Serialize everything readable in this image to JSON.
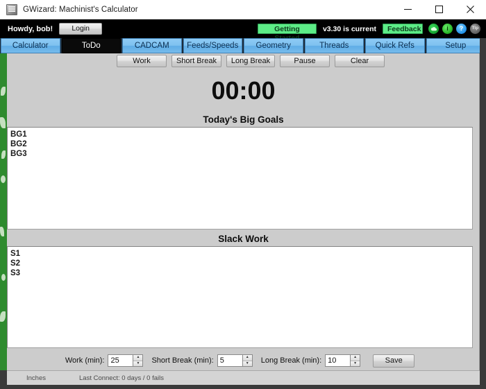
{
  "window": {
    "title": "GWizard: Machinist's Calculator",
    "app_icon": "app-window-icon",
    "minimize": "─",
    "maximize": "☐",
    "close": "✕"
  },
  "header": {
    "greeting": "Howdy, bob!",
    "login_label": "Login",
    "getting_started_label": "Getting Started",
    "version_text": "v3.30 is current",
    "feedback_label": "Feedback",
    "accent_green": "#5dec87",
    "background": "#000000",
    "icons": [
      {
        "name": "cloud-icon",
        "glyph": "☁"
      },
      {
        "name": "info-icon",
        "glyph": "ⓟ"
      },
      {
        "name": "help-icon",
        "glyph": "?"
      },
      {
        "name": "tip-icon",
        "glyph": "Tip"
      }
    ]
  },
  "tabs": [
    {
      "label": "Calculator",
      "active": false
    },
    {
      "label": "ToDo",
      "active": true
    },
    {
      "label": "CADCAM",
      "active": false
    },
    {
      "label": "Feeds/Speeds",
      "active": false
    },
    {
      "label": "Geometry",
      "active": false
    },
    {
      "label": "Threads",
      "active": false
    },
    {
      "label": "Quick Refs",
      "active": false
    },
    {
      "label": "Setup",
      "active": false
    }
  ],
  "todo": {
    "timer_buttons": [
      {
        "label": "Work"
      },
      {
        "label": "Short Break"
      },
      {
        "label": "Long Break"
      },
      {
        "label": "Pause"
      },
      {
        "label": "Clear"
      }
    ],
    "timer_value": "00:00",
    "goals_heading": "Today's Big Goals",
    "goals_text": "BG1\nBG2\nBG3",
    "slack_heading": "Slack Work",
    "slack_text": "S1\nS2\nS3",
    "settings": {
      "work_label": "Work (min):",
      "work_value": "25",
      "short_break_label": "Short Break (min):",
      "short_break_value": "5",
      "long_break_label": "Long Break (min):",
      "long_break_value": "10",
      "save_label": "Save"
    }
  },
  "statusbar": {
    "units": "Inches",
    "connect": "Last Connect: 0 days / 0 fails"
  }
}
